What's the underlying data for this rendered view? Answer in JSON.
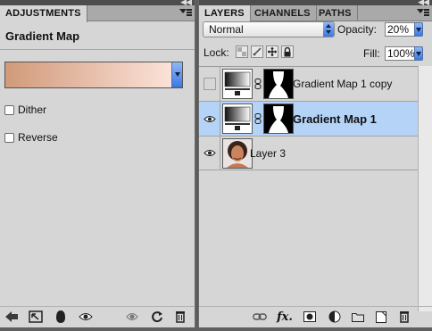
{
  "adjustments_panel": {
    "tab": "ADJUSTMENTS",
    "title": "Gradient Map",
    "gradient": {
      "from": "#d19a7a",
      "to": "#fbe2d9"
    },
    "options": [
      {
        "label": "Dither",
        "checked": false
      },
      {
        "label": "Reverse",
        "checked": false
      }
    ],
    "footer_icons": [
      "back-arrow-icon",
      "expand-view-icon",
      "clip-to-layer-icon",
      "visibility-eye-icon",
      "view-previous-state-icon",
      "reset-icon",
      "delete-icon"
    ]
  },
  "layers_panel": {
    "tabs": [
      "LAYERS",
      "CHANNELS",
      "PATHS"
    ],
    "active_tab": "LAYERS",
    "blend_mode": "Normal",
    "opacity_label": "Opacity:",
    "opacity_value": "20%",
    "lock_label": "Lock:",
    "fill_label": "Fill:",
    "fill_value": "100%",
    "layers": [
      {
        "name": "Gradient Map 1 copy",
        "visible": false,
        "selected": false,
        "type": "adjustment"
      },
      {
        "name": "Gradient Map 1",
        "visible": true,
        "selected": true,
        "type": "adjustment"
      },
      {
        "name": "Layer 3",
        "visible": true,
        "selected": false,
        "type": "pixel"
      }
    ],
    "footer_icons": [
      "link-layers-icon",
      "fx-icon",
      "add-mask-icon",
      "new-adjustment-icon",
      "new-group-icon",
      "new-layer-icon",
      "delete-layer-icon"
    ]
  }
}
